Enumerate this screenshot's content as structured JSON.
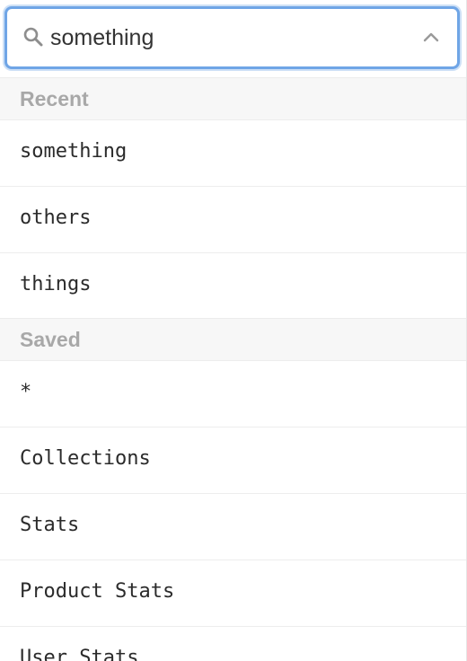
{
  "search": {
    "value": "something",
    "search_icon": "search-icon",
    "toggle_icon": "chevron-up-icon"
  },
  "recent": {
    "header": "Recent",
    "items": [
      "something",
      "others",
      "things"
    ]
  },
  "saved": {
    "header": "Saved",
    "items": [
      "*",
      "Collections",
      "Stats",
      "Product Stats",
      "User Stats"
    ]
  },
  "colors": {
    "focus_border": "#6fa5e6",
    "header_bg": "#f7f7f7",
    "header_text": "#a8a8a8",
    "item_text": "#2b2b2b"
  }
}
